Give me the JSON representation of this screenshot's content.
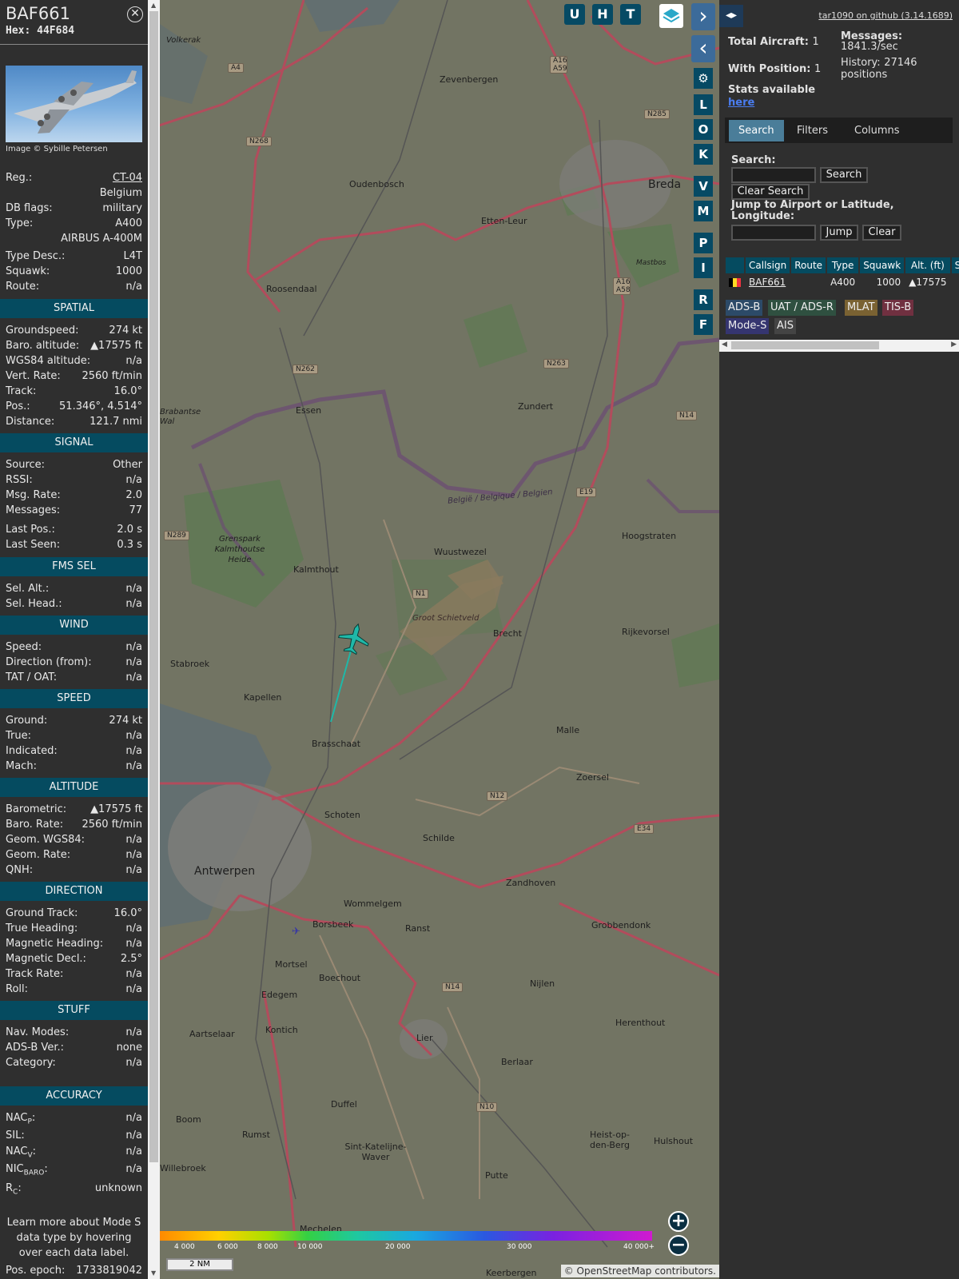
{
  "info": {
    "callsign": "BAF661",
    "hex_label": "Hex:",
    "hex": "44F684",
    "close_icon": "close-icon",
    "photo_credit": "Image © Sybille Petersen",
    "reg_label": "Reg.:",
    "reg": "CT-04",
    "country": "Belgium",
    "dbflags_label": "DB flags:",
    "dbflags": "military",
    "type_label": "Type:",
    "type": "A400",
    "type_full": "AIRBUS A-400M",
    "typedesc_label": "Type Desc.:",
    "typedesc": "L4T",
    "squawk_label": "Squawk:",
    "squawk": "1000",
    "route_label": "Route:",
    "route": "n/a",
    "spatial": {
      "title": "SPATIAL",
      "rows": [
        {
          "k": "Groundspeed:",
          "v": "274 kt"
        },
        {
          "k": "Baro. altitude:",
          "v": "▲17575 ft"
        },
        {
          "k": "WGS84 altitude:",
          "v": "n/a"
        },
        {
          "k": "Vert. Rate:",
          "v": "2560 ft/min"
        },
        {
          "k": "Track:",
          "v": "16.0°"
        },
        {
          "k": "Pos.:",
          "v": "51.346°, 4.514°"
        },
        {
          "k": "Distance:",
          "v": "121.7 nmi"
        }
      ]
    },
    "signal": {
      "title": "SIGNAL",
      "rows": [
        {
          "k": "Source:",
          "v": "Other"
        },
        {
          "k": "RSSI:",
          "v": "n/a"
        },
        {
          "k": "Msg. Rate:",
          "v": "2.0"
        },
        {
          "k": "Messages:",
          "v": "77"
        },
        {
          "k": "Last Pos.:",
          "v": "2.0 s"
        },
        {
          "k": "Last Seen:",
          "v": "0.3 s"
        }
      ]
    },
    "fms": {
      "title": "FMS SEL",
      "rows": [
        {
          "k": "Sel. Alt.:",
          "v": "n/a"
        },
        {
          "k": "Sel. Head.:",
          "v": "n/a"
        }
      ]
    },
    "wind": {
      "title": "WIND",
      "rows": [
        {
          "k": "Speed:",
          "v": "n/a"
        },
        {
          "k": "Direction (from):",
          "v": "n/a"
        },
        {
          "k": "TAT / OAT:",
          "v": "n/a"
        }
      ]
    },
    "speed": {
      "title": "SPEED",
      "rows": [
        {
          "k": "Ground:",
          "v": "274 kt"
        },
        {
          "k": "True:",
          "v": "n/a"
        },
        {
          "k": "Indicated:",
          "v": "n/a"
        },
        {
          "k": "Mach:",
          "v": "n/a"
        }
      ]
    },
    "altitude": {
      "title": "ALTITUDE",
      "rows": [
        {
          "k": "Barometric:",
          "v": "▲17575 ft"
        },
        {
          "k": "Baro. Rate:",
          "v": "2560 ft/min"
        },
        {
          "k": "Geom. WGS84:",
          "v": "n/a"
        },
        {
          "k": "Geom. Rate:",
          "v": "n/a"
        },
        {
          "k": "QNH:",
          "v": "n/a"
        }
      ]
    },
    "direction": {
      "title": "DIRECTION",
      "rows": [
        {
          "k": "Ground Track:",
          "v": "16.0°"
        },
        {
          "k": "True Heading:",
          "v": "n/a"
        },
        {
          "k": "Magnetic Heading:",
          "v": "n/a"
        },
        {
          "k": "Magnetic Decl.:",
          "v": "2.5°"
        },
        {
          "k": "Track Rate:",
          "v": "n/a"
        },
        {
          "k": "Roll:",
          "v": "n/a"
        }
      ]
    },
    "stuff": {
      "title": "STUFF",
      "rows": [
        {
          "k": "Nav. Modes:",
          "v": "n/a"
        },
        {
          "k": "ADS-B Ver.:",
          "v": "none"
        },
        {
          "k": "Category:",
          "v": "n/a"
        }
      ]
    },
    "accuracy": {
      "title": "ACCURACY",
      "nacp_k": "NAC",
      "nacp_sub": "P",
      "nacp_v": "n/a",
      "sil_k": "SIL:",
      "sil_v": "n/a",
      "nacv_k": "NAC",
      "nacv_sub": "V",
      "nacv_v": "n/a",
      "nic_k": "NIC",
      "nic_sub": "BARO",
      "nic_v": "n/a",
      "rc_k": "R",
      "rc_sub": "C",
      "rc_v": "unknown"
    },
    "note": "Learn more about Mode S data type by hovering over each data label.",
    "epoch_label": "Pos. epoch:",
    "epoch": "1733819042"
  },
  "map": {
    "aircraft_icon": "airplane-icon",
    "aircraft_color": "#1fb8a8",
    "places": [
      {
        "name": "Zevenbergen"
      },
      {
        "name": "Oudenbosch"
      },
      {
        "name": "Etten-Leur"
      },
      {
        "name": "Breda"
      },
      {
        "name": "Roosendaal"
      },
      {
        "name": "Essen"
      },
      {
        "name": "Zundert"
      },
      {
        "name": "Hoogstraten"
      },
      {
        "name": "Wuustwezel"
      },
      {
        "name": "Kalmthout"
      },
      {
        "name": "Brecht"
      },
      {
        "name": "Rijkevorsel"
      },
      {
        "name": "Stabroek"
      },
      {
        "name": "Kapellen"
      },
      {
        "name": "Brasschaat"
      },
      {
        "name": "Malle"
      },
      {
        "name": "Zoersel"
      },
      {
        "name": "Schoten"
      },
      {
        "name": "Schilde"
      },
      {
        "name": "Antwerpen"
      },
      {
        "name": "Wommelgem"
      },
      {
        "name": "Zandhoven"
      },
      {
        "name": "Borsbeek"
      },
      {
        "name": "Ranst"
      },
      {
        "name": "Grobbendonk"
      },
      {
        "name": "Mortsel"
      },
      {
        "name": "Boechout"
      },
      {
        "name": "Nijlen"
      },
      {
        "name": "Edegem"
      },
      {
        "name": "Herenthout"
      },
      {
        "name": "Kontich"
      },
      {
        "name": "Aartselaar"
      },
      {
        "name": "Lier"
      },
      {
        "name": "Berlaar"
      },
      {
        "name": "Duffel"
      },
      {
        "name": "Boom"
      },
      {
        "name": "Rumst"
      },
      {
        "name": "Heist-op-den-Berg"
      },
      {
        "name": "Hulshout"
      },
      {
        "name": "Sint-Katelijne-Waver"
      },
      {
        "name": "Putte"
      },
      {
        "name": "Willebroek"
      },
      {
        "name": "Mechelen"
      },
      {
        "name": "Keerbergen"
      },
      {
        "name": "Volkerak"
      },
      {
        "name": "Mastbos"
      },
      {
        "name": "Grenspark Kalmthoutse Heide"
      },
      {
        "name": "Groot Schietveld"
      },
      {
        "name": "België / Belgique / Belgien"
      },
      {
        "name": "Brabantse Wal"
      }
    ],
    "road_shields": [
      "A4",
      "A16 A59",
      "N285",
      "N268",
      "A16 A58",
      "N262",
      "N263",
      "N14",
      "E19",
      "N289",
      "N1",
      "N12",
      "E34",
      "N14",
      "N10"
    ],
    "toolbar": {
      "u": "U",
      "h": "H",
      "t": "T"
    },
    "side_buttons": [
      "L",
      "O",
      "K",
      "V",
      "M",
      "P",
      "I",
      "R",
      "F"
    ],
    "settings_icon": "gear-icon",
    "layers_icon": "layers-icon",
    "alt_ticks": [
      "4 000",
      "6 000",
      "8 000",
      "10 000",
      "20 000",
      "30 000",
      "40 000+"
    ],
    "scale": "2 NM",
    "copyright": "© OpenStreetMap contributors.",
    "zoom_in": "+",
    "zoom_out": "−"
  },
  "right": {
    "github": "tar1090 on github (3.14.1689)",
    "total_aircraft_label": "Total Aircraft:",
    "total_aircraft": "1",
    "with_position_label": "With Position:",
    "with_position": "1",
    "messages_label": "Messages:",
    "messages": "1841.3/sec",
    "history_label": "History:",
    "history": "27146 positions",
    "stats_label": "Stats available",
    "stats_link": "here",
    "tabs": [
      "Search",
      "Filters",
      "Columns"
    ],
    "search_label": "Search:",
    "search_button": "Search",
    "clear_search_button": "Clear Search",
    "jump_label": "Jump to Airport or Latitude, Longitude:",
    "jump_button": "Jump",
    "clear_button": "Clear",
    "table": {
      "columns": [
        "",
        "Callsign",
        "Route",
        "Type",
        "Squawk",
        "Alt. (ft)",
        "Spd"
      ],
      "row": {
        "flag": "Belgium",
        "callsign": "BAF661",
        "route": "",
        "type": "A400",
        "squawk": "1000",
        "alt": "▲17575",
        "spd": ""
      }
    },
    "sources": [
      "ADS-B",
      "UAT / ADS-R",
      "MLAT",
      "TIS-B",
      "Mode-S",
      "AIS"
    ]
  },
  "colors": {
    "section_bg": "#054b60",
    "panel_bg": "#2f2f2f",
    "adsb": "#2c4a68",
    "uat": "#2f5040",
    "mlat": "#7a6232",
    "tisb": "#703040",
    "modes": "#353570",
    "ais": "#444444"
  }
}
